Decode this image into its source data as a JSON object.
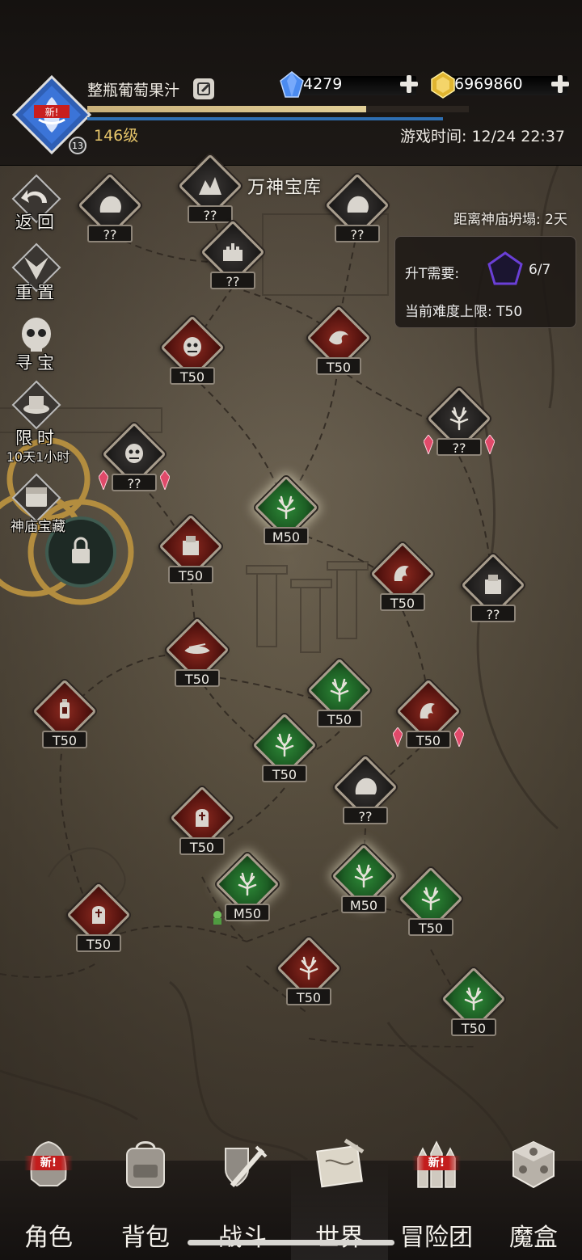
{
  "header": {
    "player_name": "整瓶葡萄果汁",
    "level": "146级",
    "avatar_badge": "新!",
    "avatar_rank": "13",
    "exp_progress": 0.73,
    "game_time": "游戏时间: 12/24 22:37",
    "gems": "4279",
    "gold": "6969860"
  },
  "map": {
    "title": "万神宝库",
    "collapse_countdown": "距离神庙坍塌: 2天",
    "info_panel": {
      "upgrade_label": "升T需要:",
      "upgrade_count": "6/7",
      "difficulty_cap": "当前难度上限: T50"
    },
    "side_buttons": {
      "back": "返回",
      "reset": "重置",
      "treasure_hunt": "寻宝",
      "limited": "限时",
      "limited_time": "10天1小时",
      "temple_treasure": "神庙宝藏"
    },
    "nodes": [
      {
        "label": "??",
        "kind": "dark",
        "icon": "mountain-icon"
      },
      {
        "label": "??",
        "kind": "dark",
        "icon": "boulder-icon"
      },
      {
        "label": "??",
        "kind": "dark",
        "icon": "boulder-icon"
      },
      {
        "label": "??",
        "kind": "dark",
        "icon": "castle-icon"
      },
      {
        "label": "T50",
        "kind": "red",
        "icon": "orc-head-icon"
      },
      {
        "label": "T50",
        "kind": "red",
        "icon": "dragon-icon"
      },
      {
        "label": "??",
        "kind": "dark",
        "icon": "tree-icon"
      },
      {
        "label": "??",
        "kind": "dark",
        "icon": "orc-head-icon"
      },
      {
        "label": "M50",
        "kind": "green",
        "icon": "tree-icon"
      },
      {
        "label": "T50",
        "kind": "red",
        "icon": "crate-icon"
      },
      {
        "label": "T50",
        "kind": "red",
        "icon": "claw-icon"
      },
      {
        "label": "??",
        "kind": "dark",
        "icon": "crate-icon"
      },
      {
        "label": "T50",
        "kind": "red",
        "icon": "wreckage-icon"
      },
      {
        "label": "T50",
        "kind": "green",
        "icon": "tree-icon"
      },
      {
        "label": "T50",
        "kind": "red",
        "icon": "lantern-icon"
      },
      {
        "label": "T50",
        "kind": "red",
        "icon": "claw-icon"
      },
      {
        "label": "T50",
        "kind": "green",
        "icon": "tree-icon"
      },
      {
        "label": "??",
        "kind": "dark",
        "icon": "boulder-icon"
      },
      {
        "label": "T50",
        "kind": "red",
        "icon": "tombstone-icon"
      },
      {
        "label": "M50",
        "kind": "green",
        "icon": "tree-icon"
      },
      {
        "label": "M50",
        "kind": "green",
        "icon": "tree-icon"
      },
      {
        "label": "T50",
        "kind": "green",
        "icon": "tree-icon"
      },
      {
        "label": "T50",
        "kind": "red",
        "icon": "tombstone-icon"
      },
      {
        "label": "T50",
        "kind": "red",
        "icon": "tree-icon"
      },
      {
        "label": "T50",
        "kind": "green",
        "icon": "tree-icon"
      }
    ]
  },
  "nav": {
    "items": [
      {
        "label": "角色",
        "icon": "helmet-icon",
        "badge": "新!"
      },
      {
        "label": "背包",
        "icon": "backpack-icon",
        "badge": ""
      },
      {
        "label": "战斗",
        "icon": "sword-shield-icon",
        "badge": ""
      },
      {
        "label": "世界",
        "icon": "scroll-map-icon",
        "badge": ""
      },
      {
        "label": "冒险团",
        "icon": "castle-towers-icon",
        "badge": "新!"
      },
      {
        "label": "魔盒",
        "icon": "magic-cube-icon",
        "badge": ""
      }
    ]
  },
  "colors": {
    "red_node": "#5a1510",
    "green_node": "#1d5e24",
    "dark_node": "#232120",
    "level_gold": "#e6c56a",
    "exp_bar": "#e2cf97",
    "blue_bar": "#2e6fb3"
  }
}
